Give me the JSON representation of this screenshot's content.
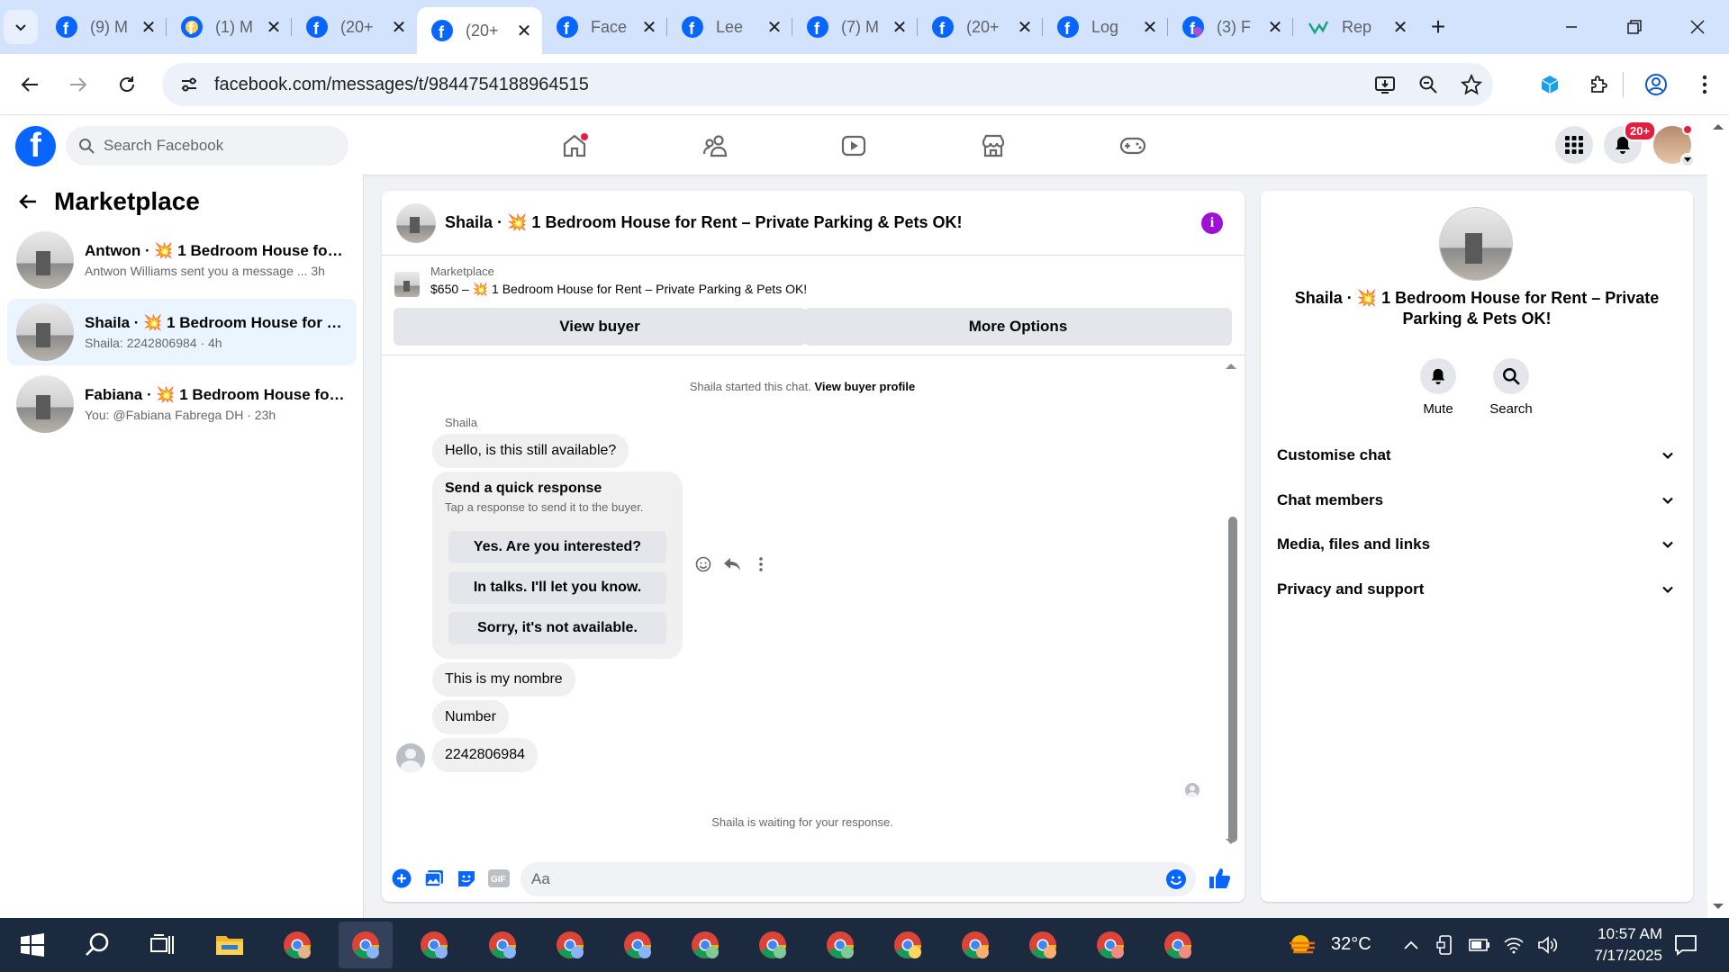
{
  "browser": {
    "tabs": [
      {
        "title": "(9) M",
        "favicon": "facebook-icon",
        "active": false
      },
      {
        "title": "(1) M",
        "favicon": "facebook-messenger-icon",
        "active": false
      },
      {
        "title": "(20+",
        "favicon": "facebook-messenger-icon",
        "active": false
      },
      {
        "title": "(20+",
        "favicon": "facebook-messenger-icon",
        "active": true
      },
      {
        "title": "Face",
        "favicon": "facebook-messenger-icon",
        "active": false
      },
      {
        "title": "Lee",
        "favicon": "facebook-messenger-icon",
        "active": false
      },
      {
        "title": "(7) M",
        "favicon": "facebook-icon",
        "active": false
      },
      {
        "title": "(20+",
        "favicon": "facebook-icon",
        "active": false
      },
      {
        "title": "Log",
        "favicon": "facebook-messenger-icon",
        "active": false
      },
      {
        "title": "(3) F",
        "favicon": "facebook-icon",
        "active": false
      },
      {
        "title": "Rep",
        "favicon": "chart-icon",
        "active": false
      }
    ],
    "url": "facebook.com/messages/t/9844754188964515"
  },
  "fbnav": {
    "search_placeholder": "Search Facebook",
    "notification_badge": "20+"
  },
  "sidebar": {
    "title": "Marketplace",
    "conversations": [
      {
        "name": "Antwon · 💥 1 Bedroom House for ...",
        "preview": "Antwon Williams sent you a message ... 3h",
        "active": false
      },
      {
        "name": "Shaila · 💥 1 Bedroom House for R...",
        "preview": "Shaila: 2242806984 · 4h",
        "active": true
      },
      {
        "name": "Fabiana · 💥 1 Bedroom House for ...",
        "preview": "You: @Fabiana Fabrega DH · 23h",
        "active": false
      }
    ]
  },
  "chat": {
    "title": "Shaila · 💥 1 Bedroom House for Rent – Private Parking & Pets OK!",
    "listing_source": "Marketplace",
    "listing_price": "$650 – 💥 1 Bedroom House for Rent – Private Parking & Pets OK!",
    "view_buyer_label": "View buyer",
    "more_options_label": "More Options",
    "started_text": "Shaila started this chat.",
    "view_profile_label": "View buyer profile",
    "sender": "Shaila",
    "messages": [
      "Hello, is this still available?",
      "This is my nombre",
      "Number",
      "2242806984"
    ],
    "quick_response": {
      "title": "Send a quick response",
      "subtitle": "Tap a response to send it to the buyer.",
      "options": [
        "Yes. Are you interested?",
        "In talks. I'll let you know.",
        "Sorry, it's not available."
      ]
    },
    "waiting_text": "Shaila is waiting for your response.",
    "composer_placeholder": "Aa"
  },
  "details": {
    "title": "Shaila · 💥 1 Bedroom House for Rent – Private Parking & Pets OK!",
    "mute_label": "Mute",
    "search_label": "Search",
    "sections": [
      "Customise chat",
      "Chat members",
      "Media, files and links",
      "Privacy and support"
    ]
  },
  "taskbar": {
    "temperature": "32°C",
    "time": "10:57 AM",
    "date": "7/17/2025"
  },
  "colors": {
    "fb_blue": "#0866ff",
    "tab_bar": "#d3e3fd",
    "active_conversation": "#ebf5ff",
    "info_purple": "#9b12d6",
    "taskbar": "#1c2a3f"
  }
}
